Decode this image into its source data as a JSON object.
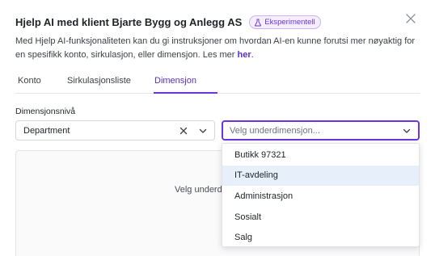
{
  "dialog": {
    "title": "Hjelp AI med klient Bjarte Bygg og Anlegg AS",
    "badge_label": "Eksperimentell",
    "description": "Med Hjelp AI-funksjonaliteten kan du gi instruksjoner om hvordan AI-en kunne forutsi mer nøyaktig for en spesifikk konto, sirkulasjon, eller dimensjon. Les mer ",
    "description_link": "her",
    "description_end": "."
  },
  "tabs": [
    {
      "label": "Konto",
      "active": false
    },
    {
      "label": "Sirkulasjonsliste",
      "active": false
    },
    {
      "label": "Dimensjon",
      "active": true
    }
  ],
  "dimension_level": {
    "label": "Dimensjonsnivå",
    "value": "Department"
  },
  "subdimension": {
    "placeholder": "Velg underdimensjon...",
    "options": [
      {
        "label": "Butikk 97321",
        "highlighted": false
      },
      {
        "label": "IT-avdeling",
        "highlighted": true
      },
      {
        "label": "Administrasjon",
        "highlighted": false
      },
      {
        "label": "Sosialt",
        "highlighted": false
      },
      {
        "label": "Salg",
        "highlighted": false
      }
    ]
  },
  "panel": {
    "text": "Velg underdi"
  },
  "colors": {
    "accent": "#6b34e0",
    "highlight": "#e6effa"
  },
  "icons": {
    "badge": "flask-icon",
    "close": "close-icon",
    "clear": "clear-x-icon",
    "dropdown": "chevron-down-icon"
  }
}
